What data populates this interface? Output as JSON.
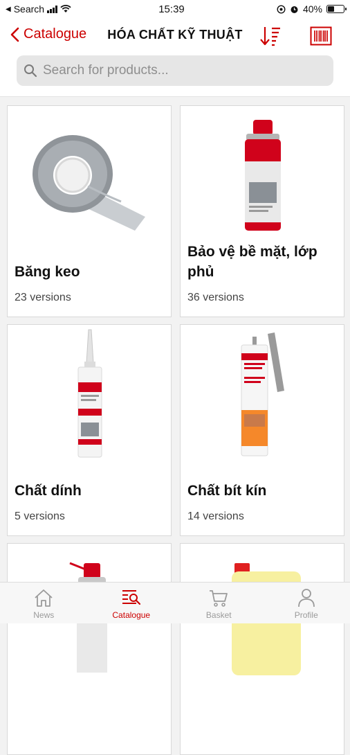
{
  "status_bar": {
    "back_app_label": "Search",
    "time": "15:39",
    "battery_percent": "40%",
    "battery_level": 0.4
  },
  "header": {
    "back_label": "Catalogue",
    "title": "HÓA CHẤT KỸ THUẬT",
    "sort_icon": "sort-descending-icon",
    "barcode_icon": "barcode-scan-icon",
    "accent_color": "#cc0000"
  },
  "search": {
    "placeholder": "Search for products...",
    "value": ""
  },
  "products": [
    {
      "name": "Băng keo",
      "versions": "23 versions",
      "image": "duct-tape-roll"
    },
    {
      "name": "Bảo vệ bề mặt, lớp phủ",
      "versions": "36 versions",
      "image": "spray-can"
    },
    {
      "name": "Chất dính",
      "versions": "5 versions",
      "image": "adhesive-cartridge"
    },
    {
      "name": "Chất bít kín",
      "versions": "14 versions",
      "image": "sealant-cartridge"
    },
    {
      "name": "",
      "versions": "",
      "image": "spray-can-with-straw"
    },
    {
      "name": "",
      "versions": "",
      "image": "yellow-canister"
    }
  ],
  "tab_bar": {
    "tabs": [
      {
        "label": "News",
        "icon": "home-icon",
        "active": false
      },
      {
        "label": "Catalogue",
        "icon": "catalogue-search-icon",
        "active": true
      },
      {
        "label": "Basket",
        "icon": "cart-icon",
        "active": false
      },
      {
        "label": "Profile",
        "icon": "person-icon",
        "active": false
      }
    ]
  }
}
